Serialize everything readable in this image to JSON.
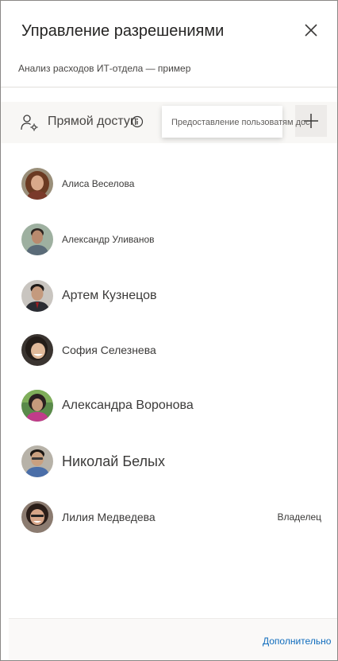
{
  "panel": {
    "title": "Управление разрешениями",
    "subtitle": "Анализ расходов ИТ-отдела — пример"
  },
  "access": {
    "label": "Прямой доступ",
    "add_tooltip": "Предоставление пользователям доступа"
  },
  "tooltip_visible": "Предоставление пользовател",
  "tooltip_overflow": "ям дос",
  "users": [
    {
      "name": "Алиса Веселова",
      "role": ""
    },
    {
      "name": "Александр Уливанов",
      "role": ""
    },
    {
      "name": "Артем Кузнецов",
      "role": ""
    },
    {
      "name": "София Селезнева",
      "role": ""
    },
    {
      "name": "Александра Воронова",
      "role": ""
    },
    {
      "name": "Николай Белых",
      "role": ""
    },
    {
      "name": "Лилия Медведева",
      "role": "Владелец"
    }
  ],
  "footer": {
    "more_link": "Дополнительно"
  },
  "colors": {
    "accent": "#0f6cbd",
    "text": "#252423",
    "bar_background": "#f8f7f5"
  }
}
